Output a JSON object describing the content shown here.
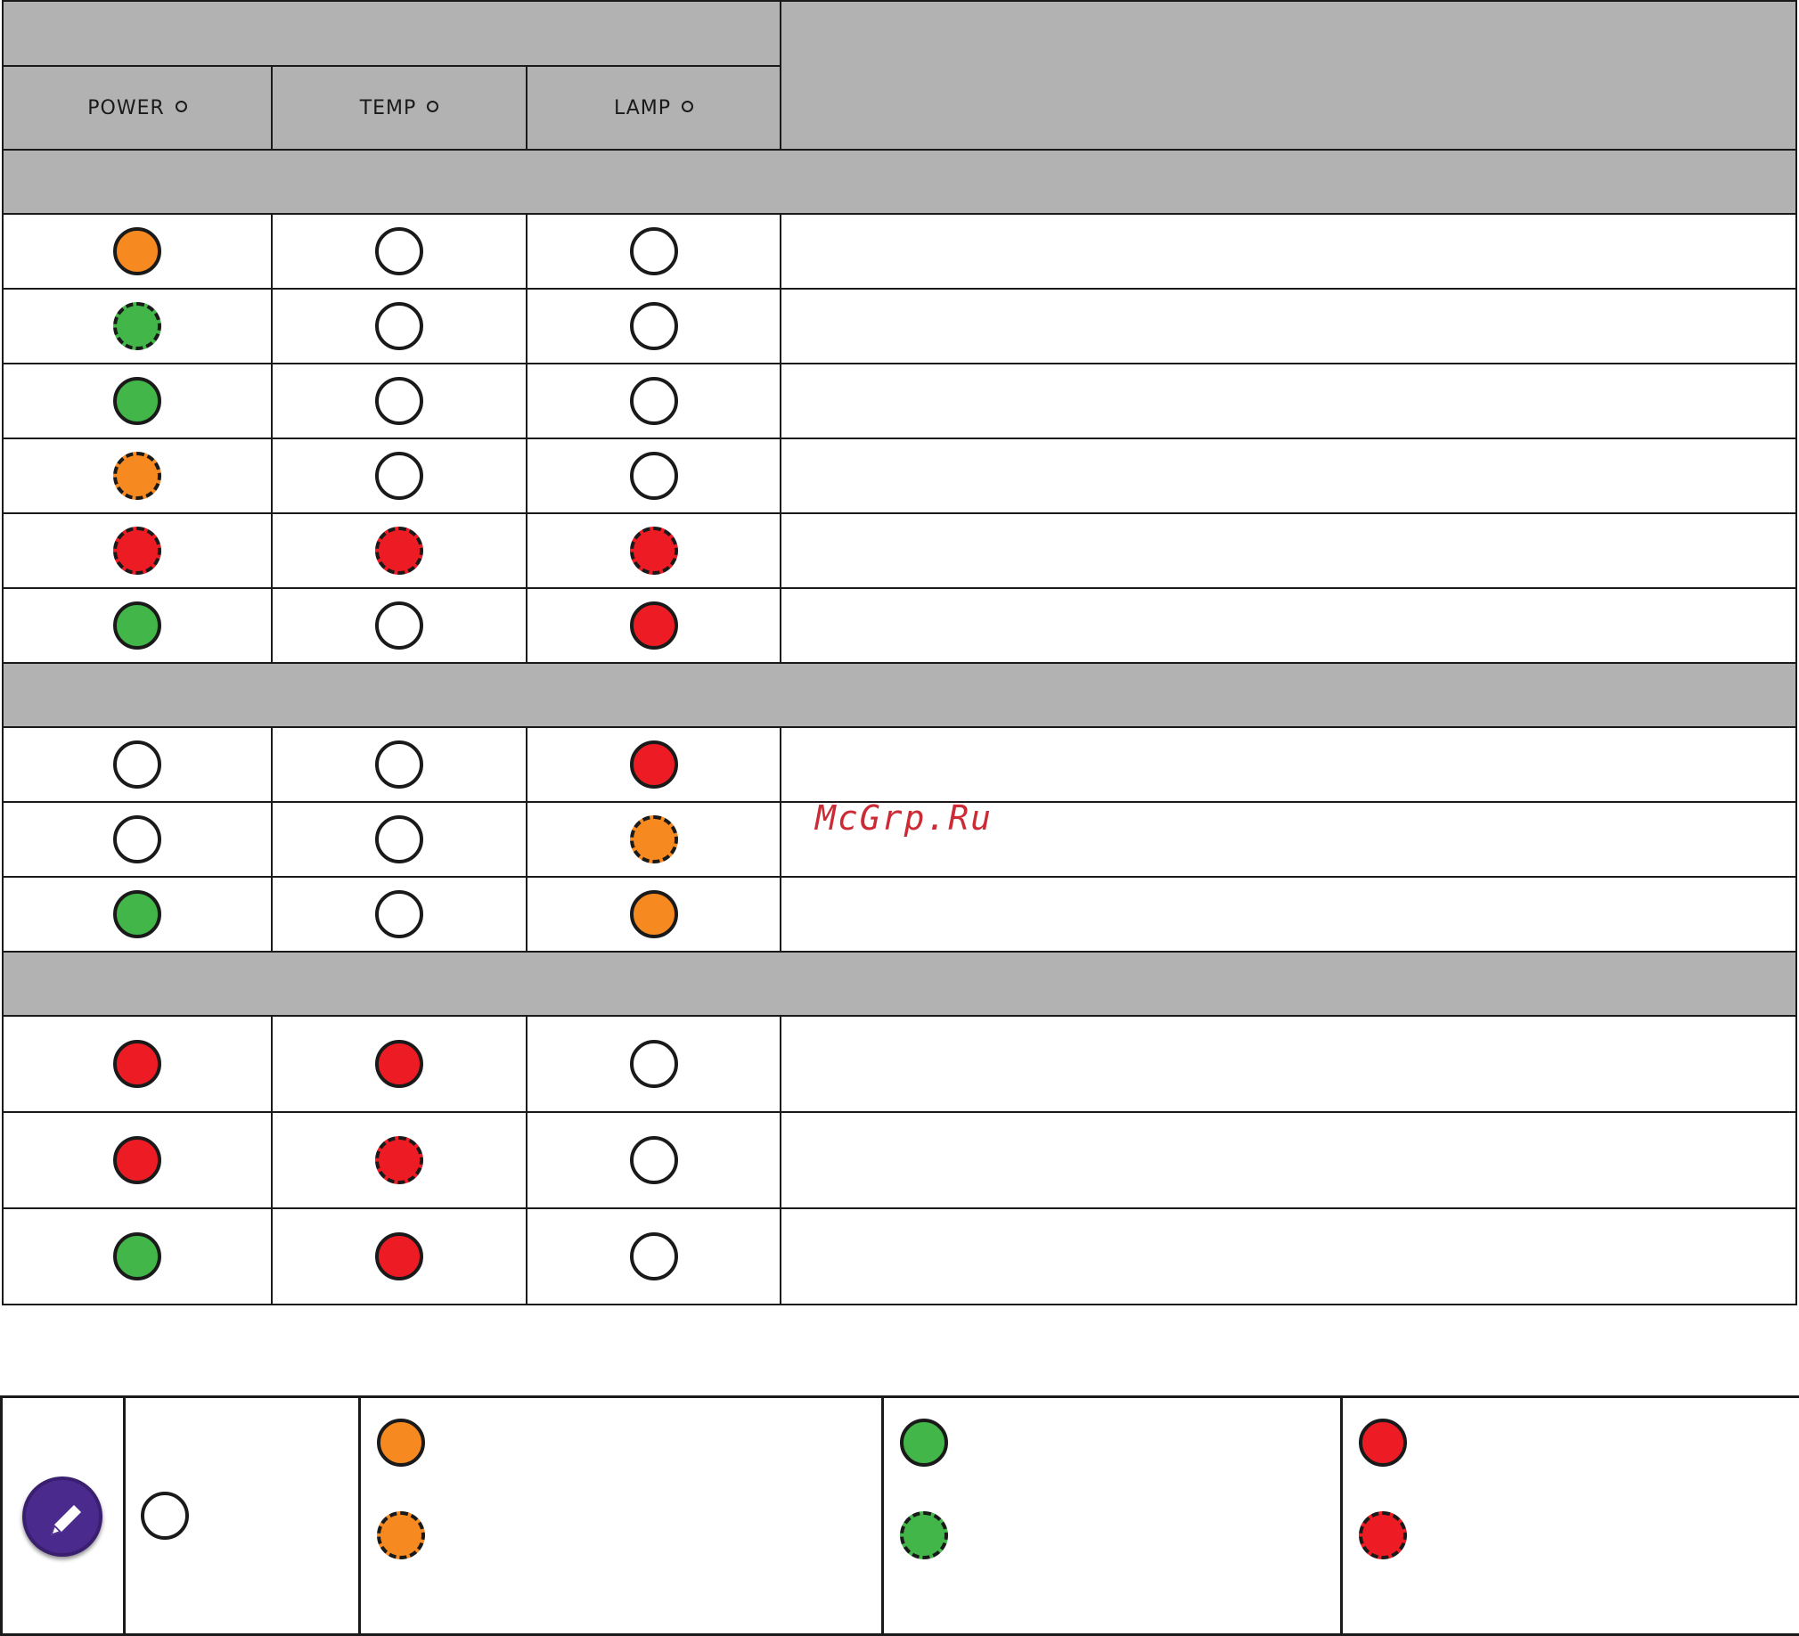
{
  "colors": {
    "off": "#ffffff",
    "orange": "#f6891f",
    "green": "#43b649",
    "red": "#ed1c24"
  },
  "header": {
    "columns": [
      {
        "label": "POWER",
        "icon": "circle-outline-icon"
      },
      {
        "label": "TEMP",
        "icon": "circle-outline-icon"
      },
      {
        "label": "LAMP",
        "icon": "circle-outline-icon"
      }
    ]
  },
  "sections": [
    {
      "rows": [
        {
          "power": "orange",
          "temp": "off",
          "lamp": "off",
          "h": 84
        },
        {
          "power": "green-flash",
          "temp": "off",
          "lamp": "off",
          "h": 84
        },
        {
          "power": "green",
          "temp": "off",
          "lamp": "off",
          "h": 84
        },
        {
          "power": "orange-flash",
          "temp": "off",
          "lamp": "off",
          "h": 84
        },
        {
          "power": "red-flash",
          "temp": "red-flash",
          "lamp": "red-flash",
          "h": 84
        },
        {
          "power": "green",
          "temp": "off",
          "lamp": "red",
          "h": 84
        }
      ]
    },
    {
      "rows": [
        {
          "power": "off",
          "temp": "off",
          "lamp": "red",
          "h": 84
        },
        {
          "power": "off",
          "temp": "off",
          "lamp": "orange-flash",
          "h": 84
        },
        {
          "power": "green",
          "temp": "off",
          "lamp": "orange",
          "h": 84
        }
      ]
    },
    {
      "rows": [
        {
          "power": "red",
          "temp": "red",
          "lamp": "off",
          "h": 108
        },
        {
          "power": "red",
          "temp": "red-flash",
          "lamp": "off",
          "h": 108
        },
        {
          "power": "green",
          "temp": "red",
          "lamp": "off",
          "h": 108
        }
      ]
    }
  ],
  "watermark": "McGrp.Ru",
  "legend": {
    "icon": "pencil-note-icon",
    "items": [
      "off",
      "orange",
      "orange-flash",
      "green",
      "green-flash",
      "red",
      "red-flash"
    ]
  }
}
